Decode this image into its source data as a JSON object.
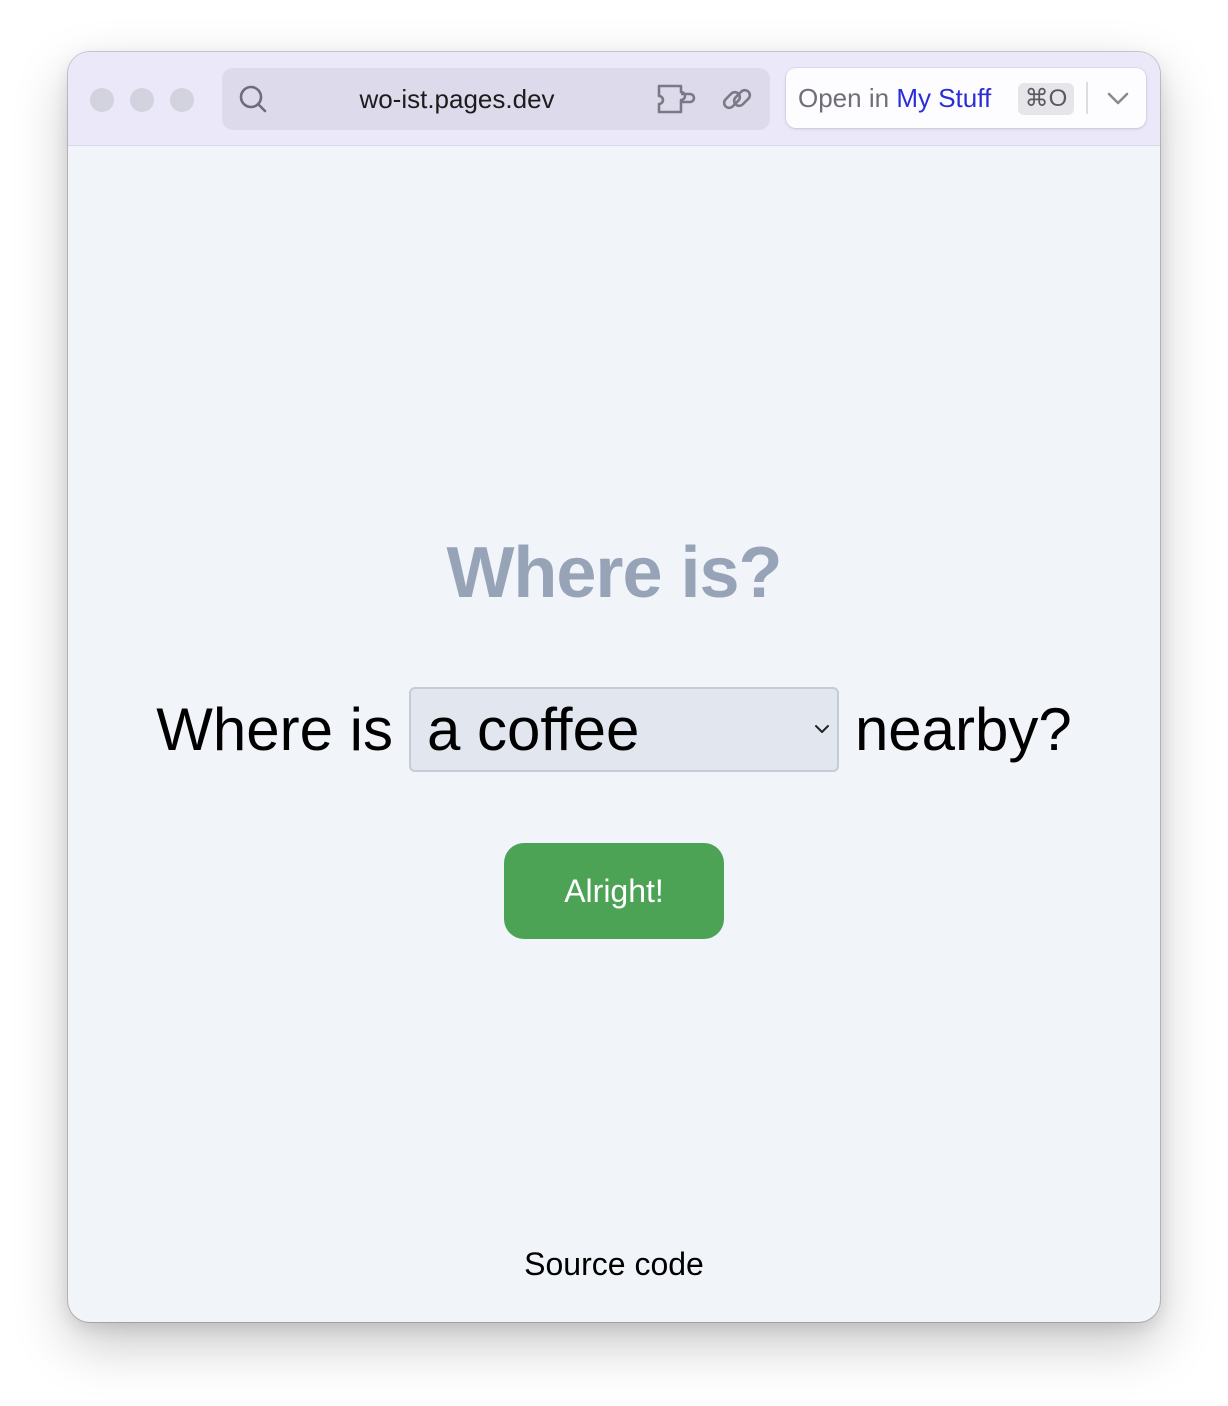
{
  "browser": {
    "url": "wo-ist.pages.dev",
    "open_in": {
      "prefix": "Open in",
      "app_name": "My Stuff",
      "shortcut": "⌘O"
    }
  },
  "page": {
    "heading": "Where is?",
    "question_prefix": "Where is",
    "selected_option": "a coffee",
    "question_suffix": "nearby?",
    "submit_label": "Alright!",
    "footer_link": "Source code"
  },
  "colors": {
    "heading": "#97a3b7",
    "button": "#4ca356",
    "brand_link": "#2b2ed6",
    "background": "#f1f4f9"
  }
}
